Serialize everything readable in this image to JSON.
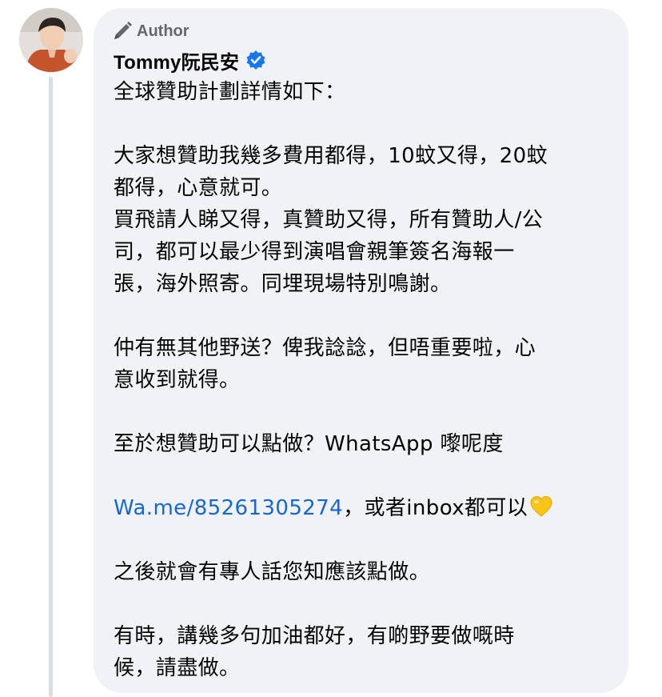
{
  "post": {
    "author_badge": "Author",
    "author_name": "Tommy阮民安",
    "colors": {
      "link": "#1766d6",
      "bubble": "#f0f2f5",
      "verified": "#1877f2",
      "heart": "#f7c41a"
    },
    "icons": {
      "badge": "pen-icon",
      "verified": "verified-badge-icon",
      "emoji": "yellow-heart-emoji"
    },
    "lines": {
      "l1": "全球贊助計劃詳情如下：",
      "l2": "大家想贊助我幾多費用都得，10蚊又得，20蚊",
      "l3": "都得，心意就可。",
      "l4": "買飛請人睇又得，真贊助又得，所有贊助人/公",
      "l5": "司，都可以最少得到演唱會親筆簽名海報一",
      "l6": "張，海外照寄。同埋現場特別鳴謝。",
      "l7": "仲有無其他野送？俾我諗諗，但唔重要啦，心",
      "l8": "意收到就得。",
      "l9": "至於想贊助可以點做？WhatsApp 嚟呢度",
      "l10_link": "Wa.me/85261305274",
      "l10_rest": "，或者inbox都可以",
      "l11": "之後就會有專人話您知應該點做。",
      "l12": "有時，講幾多句加油都好，有啲野要做嘅時",
      "l13": "候，請盡做。"
    }
  }
}
